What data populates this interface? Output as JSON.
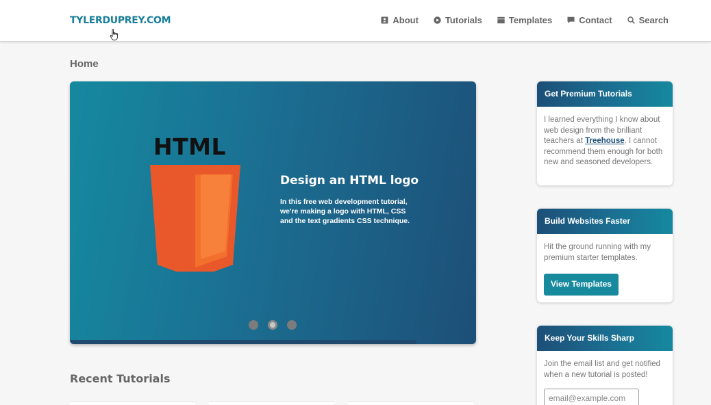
{
  "site": {
    "logo": "TYLERDUPREY.COM"
  },
  "nav": {
    "items": [
      {
        "label": "About",
        "icon": "id-card-icon"
      },
      {
        "label": "Tutorials",
        "icon": "play-circle-icon"
      },
      {
        "label": "Templates",
        "icon": "window-icon"
      },
      {
        "label": "Contact",
        "icon": "speech-bubble-icon"
      },
      {
        "label": "Search",
        "icon": "search-icon"
      }
    ]
  },
  "breadcrumb": "Home",
  "slider": {
    "logo_word": "HTML",
    "title": "Design an HTML logo",
    "description": "In this free web development tutorial, we're making a logo with HTML, CSS and the text gradients CSS technique.",
    "dots": 3,
    "active_dot": 2
  },
  "recent": {
    "title": "Recent Tutorials"
  },
  "widgets": {
    "premium": {
      "title": "Get Premium Tutorials",
      "text_before": "I learned everything I know about web design from the brilliant teachers at ",
      "link": "Treehouse",
      "text_after": ". I cannot recommend them enough for both new and seasoned developers."
    },
    "faster": {
      "title": "Build Websites Faster",
      "text": "Hit the ground running with my premium starter templates.",
      "button": "View Templates"
    },
    "skills": {
      "title": "Keep Your Skills Sharp",
      "text": "Join the email list and get notified when a new tutorial is posted!",
      "email_placeholder": "email@example.com"
    }
  },
  "colors": {
    "brand": "#1a7f9a",
    "slide_dark": "#1d4f78",
    "button": "#188a9e",
    "html_orange": "#e8582a"
  }
}
